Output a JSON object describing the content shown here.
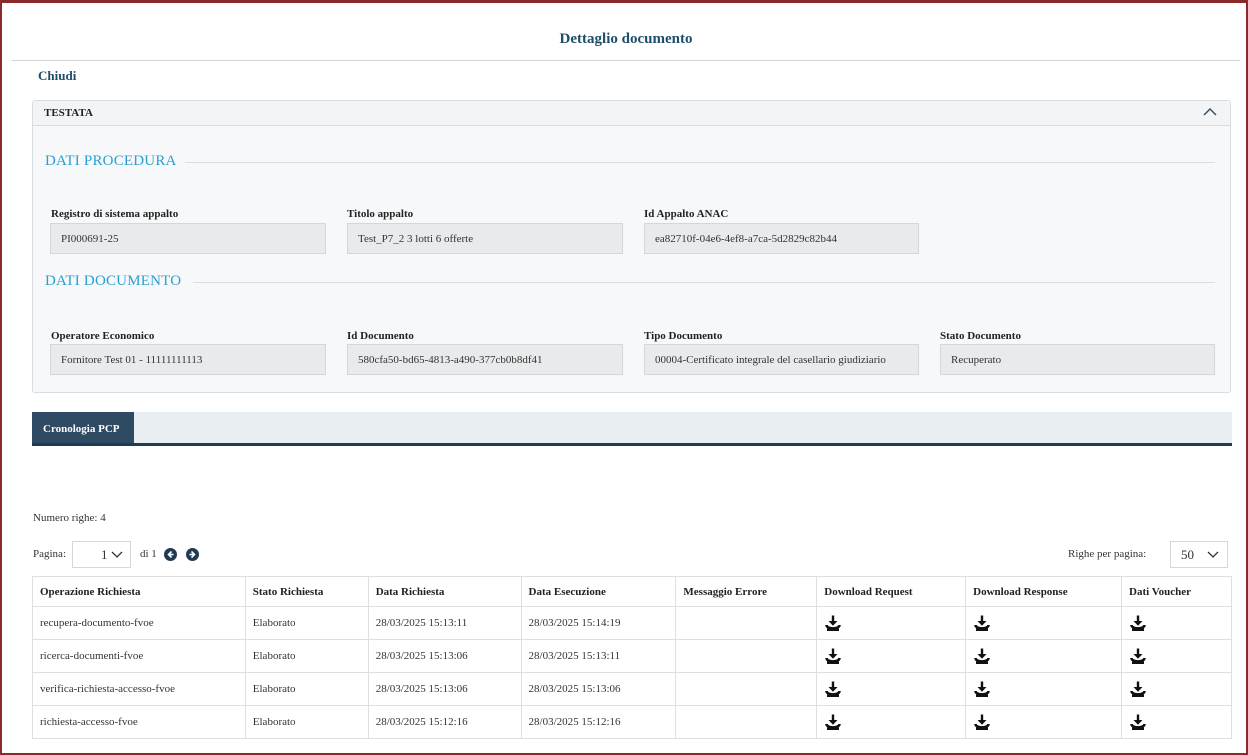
{
  "header": {
    "title": "Dettaglio documento",
    "close_label": "Chiudi"
  },
  "testata": {
    "label": "TESTATA",
    "icon": "chevron-up-icon",
    "dati_procedura": {
      "title": "DATI PROCEDURA",
      "fields": [
        {
          "label": "Registro di sistema appalto",
          "value": "PI000691-25"
        },
        {
          "label": "Titolo appalto",
          "value": "Test_P7_2 3 lotti 6 offerte"
        },
        {
          "label": "Id Appalto ANAC",
          "value": "ea82710f-04e6-4ef8-a7ca-5d2829c82b44"
        }
      ]
    },
    "dati_documento": {
      "title": "DATI DOCUMENTO",
      "fields": [
        {
          "label": "Operatore Economico",
          "value": "Fornitore Test 01 - 11111111113"
        },
        {
          "label": "Id Documento",
          "value": "580cfa50-bd65-4813-a490-377cb0b8df41"
        },
        {
          "label": "Tipo Documento",
          "value": "00004-Certificato integrale del casellario giudiziario"
        },
        {
          "label": "Stato Documento",
          "value": "Recuperato"
        }
      ]
    }
  },
  "tabs": [
    {
      "label": "Cronologia PCP",
      "active": true
    }
  ],
  "grid": {
    "row_count_label": "Numero righe: 4",
    "pager": {
      "label": "Pagina:",
      "current": "1",
      "of_label": "di 1"
    },
    "per_page": {
      "label": "Righe per pagina:",
      "value": "50"
    },
    "columns": [
      "Operazione Richiesta",
      "Stato Richiesta",
      "Data Richiesta",
      "Data Esecuzione",
      "Messaggio Errore",
      "Download Request",
      "Download Response",
      "Dati Voucher"
    ],
    "rows": [
      {
        "operazione": "recupera-documento-fvoe",
        "stato": "Elaborato",
        "data_richiesta": "28/03/2025 15:13:11",
        "data_esecuzione": "28/03/2025 15:14:19",
        "messaggio": ""
      },
      {
        "operazione": "ricerca-documenti-fvoe",
        "stato": "Elaborato",
        "data_richiesta": "28/03/2025 15:13:06",
        "data_esecuzione": "28/03/2025 15:13:11",
        "messaggio": ""
      },
      {
        "operazione": "verifica-richiesta-accesso-fvoe",
        "stato": "Elaborato",
        "data_richiesta": "28/03/2025 15:13:06",
        "data_esecuzione": "28/03/2025 15:13:06",
        "messaggio": ""
      },
      {
        "operazione": "richiesta-accesso-fvoe",
        "stato": "Elaborato",
        "data_richiesta": "28/03/2025 15:12:16",
        "data_esecuzione": "28/03/2025 15:12:16",
        "messaggio": ""
      }
    ],
    "icons": {
      "download": "download-icon",
      "prev": "prev-page-icon",
      "next": "next-page-icon"
    }
  },
  "colors": {
    "title": "#1f4e6b",
    "section": "#2a9fd0",
    "tab": "#2f4a63",
    "frame": "#8b2a2a"
  }
}
